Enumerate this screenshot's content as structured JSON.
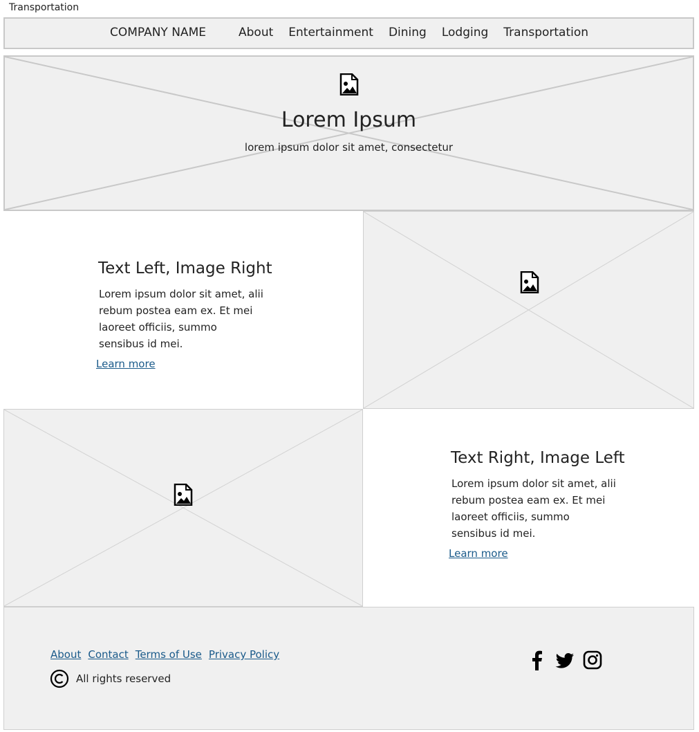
{
  "page": {
    "label": "Transportation"
  },
  "nav": {
    "brand": "COMPANY NAME",
    "links": [
      "About",
      "Entertainment",
      "Dining",
      "Lodging",
      "Transportation"
    ]
  },
  "hero": {
    "title": "Lorem Ipsum",
    "subtitle": "lorem ipsum dolor sit amet, consectetur",
    "icon": "image-icon"
  },
  "features": [
    {
      "heading": "Text Left, Image Right",
      "body": "Lorem ipsum dolor sit amet, alii rebum postea eam ex. Et mei laoreet officiis, summo sensibus id mei.",
      "link": "Learn more"
    },
    {
      "heading": "Text Right, Image Left",
      "body": "Lorem ipsum dolor sit amet, alii rebum postea eam ex. Et mei laoreet officiis, summo sensibus id mei.",
      "link": "Learn more"
    }
  ],
  "footer": {
    "links": [
      "About",
      "Contact",
      "Terms of Use",
      "Privacy Policy"
    ],
    "copyright": "All rights reserved",
    "social": [
      "facebook-icon",
      "twitter-icon",
      "instagram-icon"
    ]
  },
  "colors": {
    "placeholder_bg": "#f0f0f0",
    "border": "#c8c8c8",
    "link": "#1a5a8a"
  }
}
